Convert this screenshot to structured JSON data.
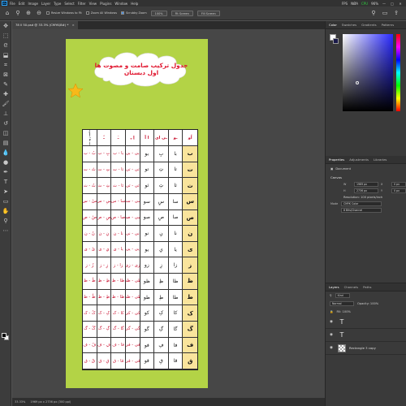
{
  "menubar": {
    "logo": "Ps",
    "items": [
      "File",
      "Edit",
      "Image",
      "Layer",
      "Type",
      "Select",
      "Filter",
      "View",
      "Plugins",
      "Window",
      "Help"
    ],
    "fps": "FPS",
    "bars": "NØA",
    "cpu": "CPU",
    "cpu_value": "96%",
    "minimize": "—",
    "maximize": "□",
    "close": "✕"
  },
  "options": {
    "resize_windows": "Resize Windows to Fit",
    "zoom_all": "Zoom All Windows",
    "scrubby_zoom": "Scrubby Zoom",
    "zoom_value": "100%",
    "fit_screen": "Fit Screen",
    "fill_screen": "Fill Screen"
  },
  "document": {
    "tab_title": "78 ll 50.psd @ 33.3% (CMYK/8#) *",
    "close": "×",
    "title": "جدول ترکیب صامت و مصوت ها اول دبستان",
    "corner_label": "صامت ها / مصوت ها",
    "header": [
      "ــُـ",
      "اُو",
      "ـو",
      "ـی ای",
      "ا آ",
      "اِ ـِ",
      "ـَ",
      "ـُ"
    ],
    "rows": [
      [
        "ب",
        "با",
        "بِ",
        "بو",
        "بی - بی",
        "با - ب",
        "بِ - ب",
        "بُ - ب"
      ],
      [
        "ت",
        "تا",
        "تِ",
        "تو",
        "تی - تی",
        "تا - ت",
        "تِ - ت",
        "تُ - ت"
      ],
      [
        "ث",
        "ثا",
        "ثِ",
        "ثو",
        "ثی - ثی",
        "ثا - ث",
        "ثِ - ث",
        "ثُ - ث"
      ],
      [
        "س",
        "سا",
        "سِ",
        "سو",
        "سی - سی",
        "سا - س",
        "سِ - س",
        "سُ - س"
      ],
      [
        "ص",
        "صا",
        "صِ",
        "صو",
        "صی - صی",
        "صا - ص",
        "صِ - ص",
        "صُ - ص"
      ],
      [
        "ن",
        "نا",
        "نِ",
        "نو",
        "نی - نی",
        "نا - ن",
        "نِ - ن",
        "نُ - ن"
      ],
      [
        "ی",
        "یا",
        "یِ",
        "یو",
        "یی - یی",
        "یا - ی",
        "یِ - ی",
        "یُ - ی"
      ],
      [
        "ز",
        "زا",
        "زِ",
        "زو",
        "زی - زی",
        "زا - ز",
        "زِ - ز",
        "زُ - ز"
      ],
      [
        "ظ",
        "ظا",
        "ظِ",
        "ظو",
        "ظی - ظی",
        "ظا - ظ",
        "ظِ - ظ",
        "ظُ - ظ"
      ],
      [
        "ط",
        "طا",
        "طِ",
        "طو",
        "طی - طی",
        "طا - ط",
        "طِ - ط",
        "طُ - ط"
      ],
      [
        "ک",
        "کا",
        "کِ",
        "کو",
        "کی - کی",
        "کا - ک",
        "کِ - ک",
        "کُ - ک"
      ],
      [
        "گ",
        "گا",
        "گِ",
        "گو",
        "گی - گی",
        "گا - گ",
        "گِ - گ",
        "گُ - گ"
      ],
      [
        "ف",
        "فا",
        "فِ",
        "فو",
        "فی - فی",
        "فا - ف",
        "فِ - ف",
        "فُ - ف"
      ],
      [
        "ق",
        "قا",
        "قِ",
        "قو",
        "قی - قی",
        "قا - ق",
        "قِ - ق",
        "قُ - ق"
      ]
    ]
  },
  "status": {
    "zoom": "33.33%",
    "size": "1969 px x 2736 px (300 ppi)"
  },
  "panels": {
    "color_tabs": [
      "Color",
      "Swatches",
      "Gradients",
      "Patterns"
    ],
    "props_tabs": [
      "Properties",
      "Adjustments",
      "Libraries"
    ],
    "document_label": "Document",
    "canvas_label": "Canvas",
    "width_label": "W",
    "width_value": "1969 px",
    "height_label": "H",
    "height_value": "2736 px",
    "x_label": "X",
    "x_value": "0 px",
    "y_label": "Y",
    "y_value": "0 px",
    "resolution": "Resolution: 100 pixels/inch",
    "mode_label": "Mode",
    "mode_value": "CMYK Color",
    "depth_value": "8 Bits/Channel",
    "layer_tabs": [
      "Layers",
      "Channels",
      "Paths"
    ],
    "kind": "Kind",
    "blend": "Normal",
    "opacity": "Opacity: 100%",
    "fill": "Fill: 100%",
    "layers": [
      {
        "icon": "T",
        "name": ""
      },
      {
        "icon": "T",
        "name": ""
      },
      {
        "icon": "thumb",
        "name": "Rectangle 3 copy"
      }
    ]
  }
}
